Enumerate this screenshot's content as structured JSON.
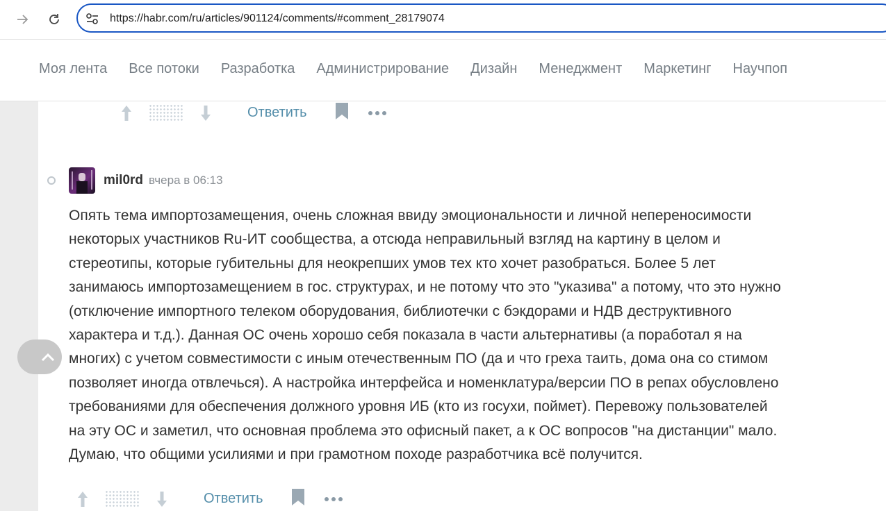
{
  "browser": {
    "url": "https://habr.com/ru/articles/901124/comments/#comment_28179074"
  },
  "site_nav": {
    "items": [
      "Моя лента",
      "Все потоки",
      "Разработка",
      "Администрирование",
      "Дизайн",
      "Менеджмент",
      "Маркетинг",
      "Научпоп"
    ]
  },
  "prev_comment_actions": {
    "reply_label": "Ответить"
  },
  "comment": {
    "author": "mil0rd",
    "time": "вчера в 06:13",
    "lines": [
      "Опять тема импортозамещения, очень сложная ввиду эмоциональности и личной непереносимости",
      "некоторых участников Ru-ИТ сообщества, а отсюда неправильный взгляд на картину в целом и",
      "стереотипы, которые губительны для неокрепших умов тех кто хочет разобраться. Более 5 лет",
      "занимаюсь импортозамещением в гос. структурах, и не потому что это \"указива\" а потому, что это нужно",
      "(отключение импортного телеком оборудования, библиотечки с бэкдорами и НДВ деструктивного",
      "характера и т.д.). Данная ОС очень хорошо себя показала в части альтернативы (а поработал я на",
      "многих) с учетом совместимости с иным отечественным ПО (да и что греха таить, дома она со стимом",
      "позволяет иногда отвлечься). А настройка интерфейса и номенклатура/версии ПО в репах обусловлено",
      "требованиями для обеспечения должного уровня ИБ (кто из госухи, поймет). Перевожу пользователей",
      "на эту ОС и заметил, что основная проблема это офисный пакет, а к ОС вопросов \"на дистанции\" мало.",
      "Думаю, что общими усилиями и при грамотном походе разработчика всё получится."
    ],
    "reply_label": "Ответить"
  },
  "icons": {
    "forward": "forward-arrow-icon",
    "reload": "reload-icon",
    "site_settings": "site-settings-icon",
    "upvote": "upvote-arrow-icon",
    "downvote": "downvote-arrow-icon",
    "bookmark": "bookmark-icon",
    "more": "more-dots-icon",
    "scroll_up": "chevron-up-icon"
  }
}
